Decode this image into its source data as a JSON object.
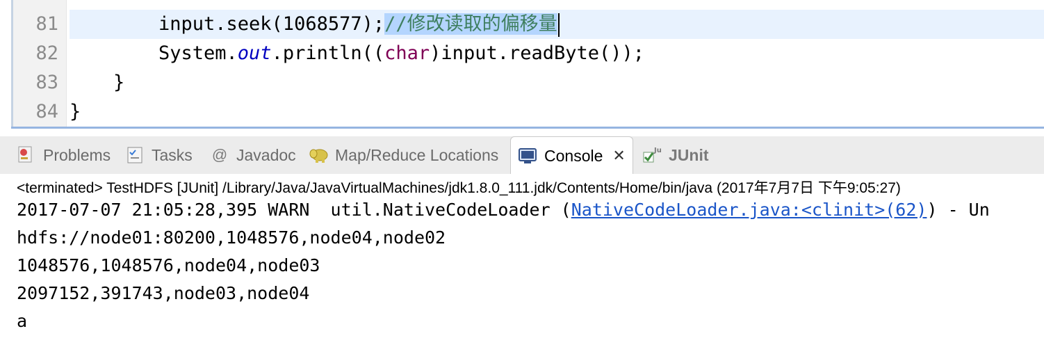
{
  "editor": {
    "line_numbers": [
      "81",
      "82",
      "83",
      "84"
    ],
    "code": {
      "l81_code": "input.seek(1068577);",
      "l81_comment": "//修改读取的偏移量",
      "l82_a": "System.",
      "l82_field": "out",
      "l82_b": ".println((",
      "l82_kw": "char",
      "l82_c": ")input.readByte());",
      "l83": "}",
      "l84": "}"
    }
  },
  "tabs": [
    {
      "label": "Problems",
      "icon": "problems-icon"
    },
    {
      "label": "Tasks",
      "icon": "tasks-icon"
    },
    {
      "label": "Javadoc",
      "icon": "at-icon"
    },
    {
      "label": "Map/Reduce Locations",
      "icon": "elephant-icon"
    },
    {
      "label": "Console",
      "icon": "console-icon",
      "active": true
    },
    {
      "label": "JUnit",
      "icon": "junit-icon"
    }
  ],
  "console": {
    "status": "<terminated> TestHDFS [JUnit] /Library/Java/JavaVirtualMachines/jdk1.8.0_111.jdk/Contents/Home/bin/java (2017年7月7日 下午9:05:27)",
    "warn_prefix": "2017-07-07 21:05:28,395 WARN  util.NativeCodeLoader (",
    "warn_link": "NativeCodeLoader.java:<clinit>(62)",
    "warn_suffix": ") - Un",
    "lines": [
      "hdfs://node01:80200,1048576,node04,node02",
      "1048576,1048576,node04,node03",
      "2097152,391743,node03,node04",
      "a"
    ]
  },
  "colors": {
    "keyword": "#7f0055",
    "field": "#0000c0",
    "comment": "#3f7f5f",
    "link": "#1a55c8",
    "current_line": "#e8f2fe",
    "selection": "#b4d5fe"
  }
}
